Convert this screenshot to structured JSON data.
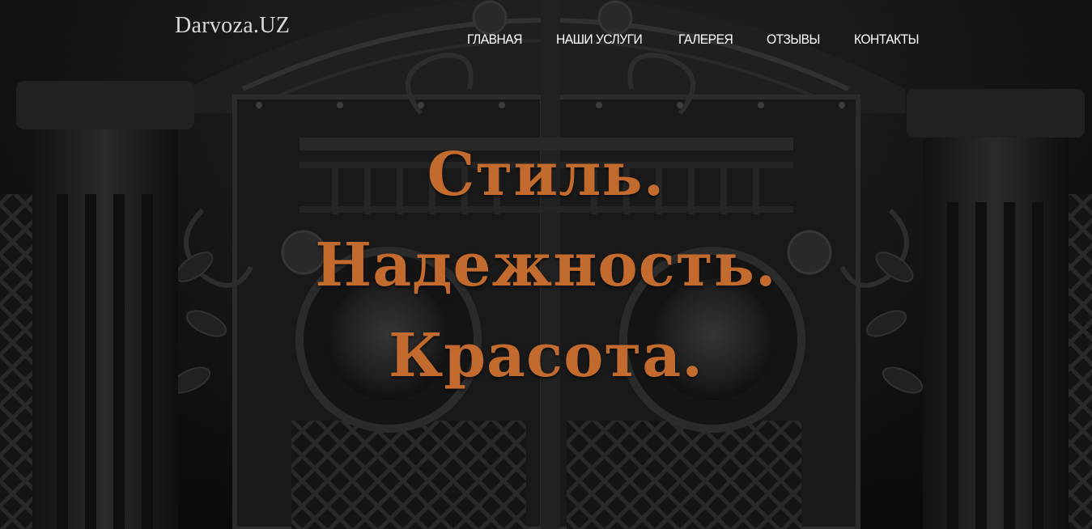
{
  "brand": {
    "logo_text": "Darvoza.UZ"
  },
  "nav": {
    "items": [
      {
        "label": "ГЛАВНАЯ"
      },
      {
        "label": "НАШИ УСЛУГИ"
      },
      {
        "label": "ГАЛЕРЕЯ"
      },
      {
        "label": "ОТЗЫВЫ"
      },
      {
        "label": "КОНТАКТЫ"
      }
    ]
  },
  "hero": {
    "lines": [
      "Стиль.",
      "Надежность.",
      "Красота."
    ],
    "accent_color": "#c36b2e",
    "background_description_icon": "wrought-iron-gate-with-lions-image"
  }
}
